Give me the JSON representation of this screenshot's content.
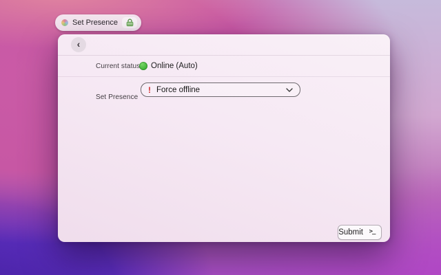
{
  "tab": {
    "title": "Set Presence"
  },
  "window": {
    "back_glyph": "‹",
    "current_status": {
      "label": "Current status",
      "value": "Online (Auto)"
    },
    "set_presence": {
      "label": "Set Presence",
      "warning_mark": "!",
      "selected_option": "Force offline"
    },
    "footer": {
      "submit_label": "Submit",
      "terminal_glyph": ">_"
    }
  },
  "colors": {
    "status_online": "#3fb136",
    "warning_red": "#d22d2d",
    "lock_green": "#76ae64"
  }
}
